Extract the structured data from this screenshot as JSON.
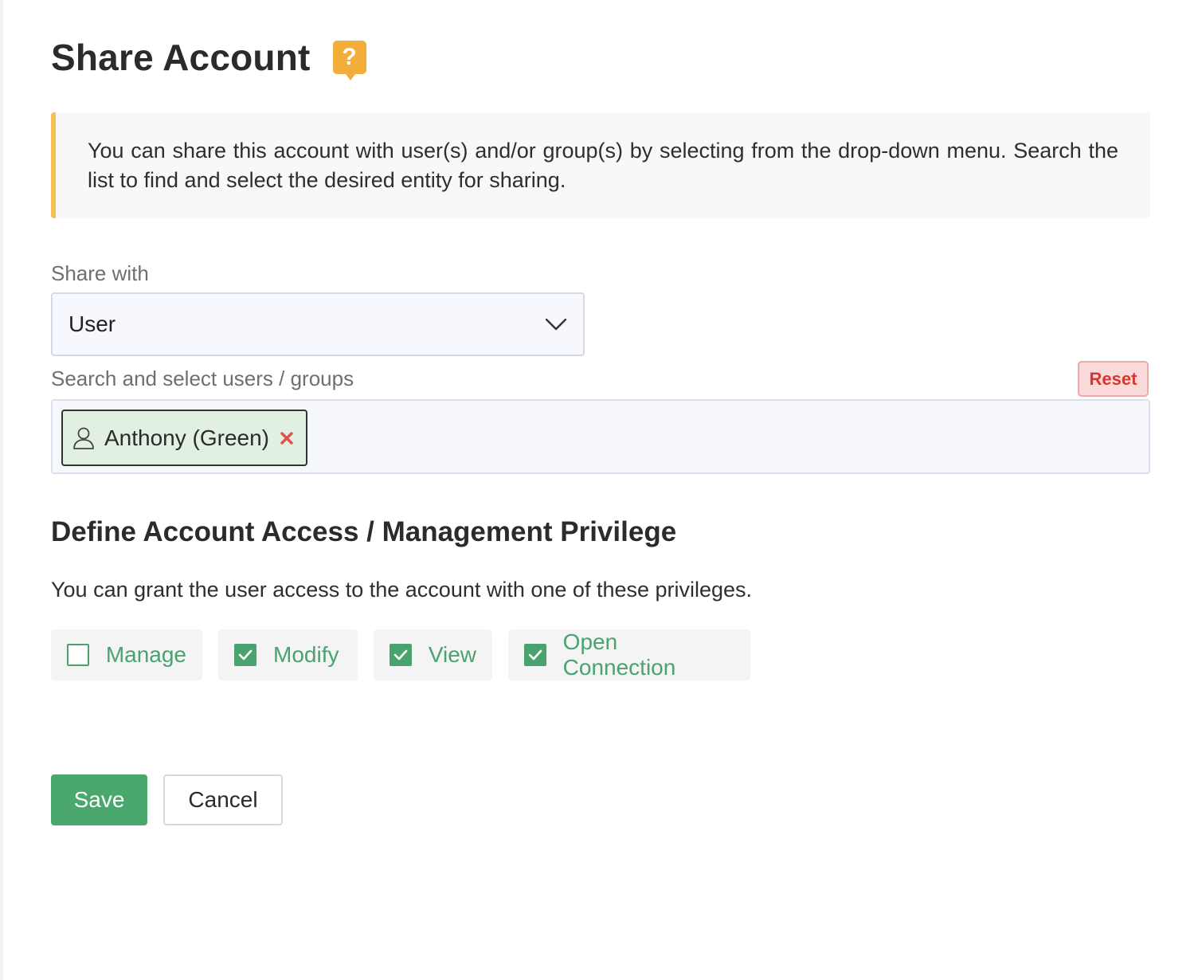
{
  "header": {
    "title": "Share Account",
    "help_glyph": "?",
    "help_icon": "question-icon"
  },
  "info": {
    "text": "You can share this account with user(s) and/or group(s) by selecting from the drop-down menu. Search the list to find and select the desired entity for sharing."
  },
  "share_with": {
    "label": "Share with",
    "selected": "User",
    "icon": "chevron-down-icon"
  },
  "search": {
    "label": "Search and select users / groups",
    "reset_label": "Reset",
    "selected_entities": [
      {
        "name": "Anthony (Green)",
        "icon": "user-icon",
        "remove_icon": "close-icon"
      }
    ]
  },
  "privileges": {
    "title": "Define Account Access / Management Privilege",
    "description": "You can grant the user access to the account with one of these privileges.",
    "options": [
      {
        "label": "Manage",
        "checked": false
      },
      {
        "label": "Modify",
        "checked": true
      },
      {
        "label": "View",
        "checked": true
      },
      {
        "label": "Open Connection",
        "checked": true
      }
    ]
  },
  "actions": {
    "save_label": "Save",
    "cancel_label": "Cancel"
  },
  "colors": {
    "accent_green": "#4aa86e",
    "warning_orange": "#f2ad3b",
    "info_border": "#f4c054",
    "reset_red": "#d9362f",
    "chip_bg": "#e2f0e2"
  }
}
